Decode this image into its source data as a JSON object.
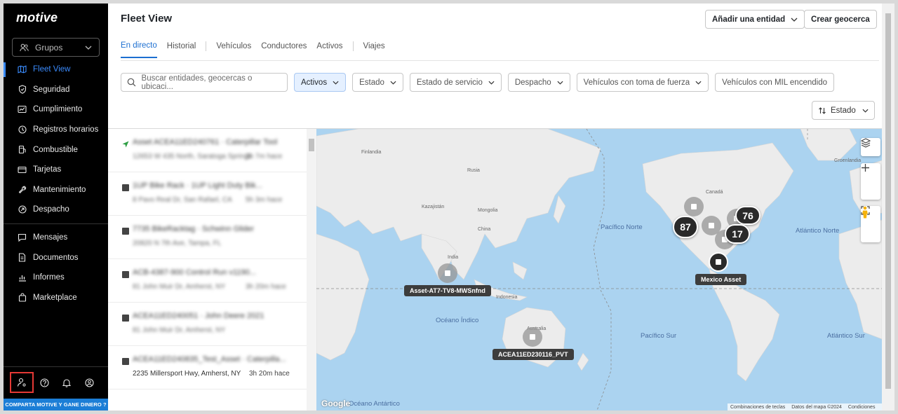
{
  "brand": "motive",
  "sidebar": {
    "groups_label": "Grupos",
    "items": [
      {
        "label": "Fleet View",
        "icon": "map-icon"
      },
      {
        "label": "Seguridad",
        "icon": "shield-icon"
      },
      {
        "label": "Cumplimiento",
        "icon": "compliance-icon"
      },
      {
        "label": "Registros horarios",
        "icon": "clock-icon"
      },
      {
        "label": "Combustible",
        "icon": "fuel-icon"
      },
      {
        "label": "Tarjetas",
        "icon": "card-icon"
      },
      {
        "label": "Mantenimiento",
        "icon": "wrench-icon"
      },
      {
        "label": "Despacho",
        "icon": "dispatch-icon"
      },
      {
        "label": "Mensajes",
        "icon": "message-icon"
      },
      {
        "label": "Documentos",
        "icon": "document-icon"
      },
      {
        "label": "Informes",
        "icon": "chart-icon"
      },
      {
        "label": "Marketplace",
        "icon": "bag-icon"
      }
    ],
    "referral": "COMPARTA MOTIVE Y GANE DINERO ?"
  },
  "header": {
    "title": "Fleet View",
    "add_entity_label": "Añadir una entidad",
    "create_geofence_label": "Crear geocerca"
  },
  "tabs": [
    "En directo",
    "Historial",
    "Vehículos",
    "Conductores",
    "Activos",
    "Viajes"
  ],
  "filters": {
    "search_placeholder": "Buscar entidades, geocercas o ubicaci...",
    "buttons": [
      "Activos",
      "Estado",
      "Estado de servicio",
      "Despacho",
      "Vehículos con toma de fuerza",
      "Vehículos con MIL encendido"
    ],
    "sort_label": "Estado"
  },
  "list": [
    {
      "title": "Asset ACEA11ED240761 · Caterpillar Tool",
      "sub": "12653 W 435 North, Saratoga Springs",
      "time": "3h 7m hace"
    },
    {
      "title": "1UP Bike Rack · 1UP Light Duty Bik...",
      "sub": "8 Pavo Real Dr, San Rafael, CA",
      "time": "5h 3m hace"
    },
    {
      "title": "7735 BikeRacktag · Schwinn Glider",
      "sub": "20820 N 7th Ave, Tampa, FL",
      "time": ""
    },
    {
      "title": "ACB-4387-900 Control Run v1190...",
      "sub": "81 John Muir Dr, Amherst, NY",
      "time": "3h 20m hace"
    },
    {
      "title": "ACEA11ED240051 · John Deere 2021",
      "sub": "81 John Muir Dr, Amherst, NY",
      "time": ""
    },
    {
      "title": "ACEA11ED240835_Test_Asset · Caterpilla...",
      "sub": "2235 Millersport Hwy, Amherst, NY",
      "time": "3h 20m hace"
    }
  ],
  "map": {
    "clusters": [
      "87",
      "76",
      "17"
    ],
    "asset_tags": [
      "Asset-AT7-TV8-MWSnfnd",
      "ACEA11ED230116_PVT",
      "Mexico Asset"
    ],
    "ocean_labels": [
      "Pacífico Norte",
      "Atlántico Norte",
      "Océano Índico",
      "Pacífico Sur",
      "Atlántico Sur",
      "Océano Antártico"
    ],
    "country_labels": [
      "Rusia",
      "Canadá",
      "Finlandia",
      "Kazajistán",
      "Mongolia",
      "China",
      "India",
      "Indonesia",
      "Australia",
      "Groenlandia"
    ],
    "attribution": [
      "Combinaciones de teclas",
      "Datos del mapa ©2024",
      "Condiciones"
    ],
    "google": "Google"
  },
  "colors": {
    "accent": "#1c6fd1",
    "sidebar_bg": "#000000",
    "ocean": "#abd3f0",
    "land": "#ececec"
  }
}
